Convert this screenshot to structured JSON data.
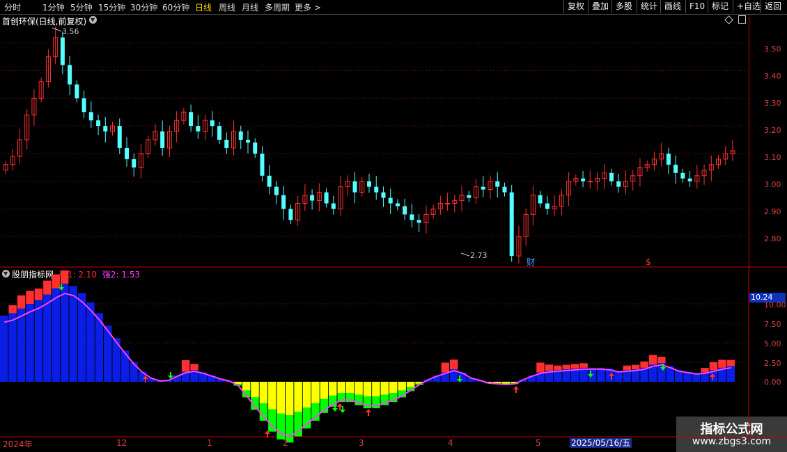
{
  "toolbar": {
    "periods": [
      "分时",
      "1分钟",
      "5分钟",
      "15分钟",
      "30分钟",
      "60分钟",
      "日线",
      "周线",
      "月线",
      "多周期",
      "更多 >"
    ],
    "active_period": "日线",
    "buttons": [
      "复权",
      "叠加",
      "多股",
      "统计",
      "画线",
      "F10",
      "标记",
      "+自选",
      "返回"
    ]
  },
  "main_chart": {
    "title": "首创环保(日线,前复权)",
    "high_label": "3.56",
    "low_label": "2.73",
    "marker_cai": "财",
    "marker_dollar": "$",
    "y_ticks": [
      "3.50",
      "3.40",
      "3.30",
      "3.20",
      "3.10",
      "3.00",
      "2.90",
      "2.80"
    ]
  },
  "indicator": {
    "name": "股朋指标网",
    "qiang1_label": "强1: 2.10",
    "qiang2_label": "强2: 1.53",
    "current_value": "10.24",
    "y_ticks": [
      "10.00",
      "7.50",
      "5.00",
      "2.50",
      "0.00"
    ]
  },
  "x_axis": {
    "labels": [
      "2024年",
      "12",
      "1",
      "2",
      "3",
      "4",
      "5"
    ],
    "date_box": "2025/05/16/五"
  },
  "watermark": {
    "line1": "指标公式网",
    "line2": "www.zbgs3.com"
  },
  "colors": {
    "up": "#ff3030",
    "down": "#54ffff",
    "bar_blue": "#0a1ee6",
    "bar_yellow": "#ffff00",
    "bar_green": "#00ff00",
    "line_magenta": "#ff40ff"
  },
  "chart_data": {
    "type": "candlestick",
    "y_range": [
      2.7,
      3.6
    ],
    "price_points": [
      3.06,
      3.09,
      3.15,
      3.24,
      3.3,
      3.36,
      3.45,
      3.52,
      3.42,
      3.35,
      3.3,
      3.25,
      3.22,
      3.2,
      3.18,
      3.2,
      3.12,
      3.08,
      3.05,
      3.1,
      3.15,
      3.18,
      3.12,
      3.18,
      3.22,
      3.25,
      3.2,
      3.18,
      3.22,
      3.2,
      3.15,
      3.12,
      3.18,
      3.15,
      3.14,
      3.1,
      3.02,
      2.98,
      2.95,
      2.9,
      2.86,
      2.92,
      2.95,
      2.93,
      2.96,
      2.92,
      2.9,
      2.98,
      3.0,
      2.96,
      3.0,
      2.98,
      2.96,
      2.94,
      2.92,
      2.91,
      2.88,
      2.86,
      2.85,
      2.88,
      2.9,
      2.92,
      2.92,
      2.93,
      2.95,
      2.94,
      2.98,
      2.97,
      3.0,
      2.98,
      2.96,
      2.73,
      2.8,
      2.88,
      2.95,
      2.92,
      2.9,
      2.91,
      2.95,
      3.0,
      3.01,
      3.0,
      3.0,
      3.01,
      3.03,
      3.0,
      2.98,
      3.0,
      3.02,
      3.05,
      3.06,
      3.08,
      3.1,
      3.06,
      3.03,
      3.01,
      3.0,
      3.02,
      3.04,
      3.06,
      3.08,
      3.1,
      3.11
    ],
    "indicator_series": [
      {
        "name": "强1",
        "value": 2.1
      },
      {
        "name": "强2",
        "value": 1.53
      }
    ],
    "indicator_bars": [
      8.5,
      8.8,
      9.4,
      10.0,
      10.5,
      11.2,
      12.0,
      12.6,
      12.3,
      11.4,
      10.2,
      8.8,
      7.2,
      5.6,
      4.0,
      2.5,
      1.3,
      0.5,
      0.1,
      0.2,
      0.8,
      1.3,
      1.5,
      1.2,
      0.8,
      0.4,
      0.1,
      -0.5,
      -2.0,
      -3.6,
      -5.0,
      -6.4,
      -7.4,
      -7.8,
      -7.0,
      -6.0,
      -5.0,
      -4.0,
      -3.2,
      -2.6,
      -2.6,
      -3.0,
      -3.4,
      -3.4,
      -3.0,
      -2.6,
      -2.0,
      -1.2,
      -0.4,
      0.3,
      0.8,
      1.2,
      1.6,
      1.2,
      0.5,
      0.2,
      -0.2,
      -0.3,
      -0.4,
      -0.3,
      0.3,
      0.8,
      1.2,
      1.4,
      1.5,
      1.6,
      1.7,
      1.8,
      1.8,
      1.8,
      1.7,
      1.4,
      1.5,
      1.6,
      1.8,
      2.2,
      2.4,
      2.0,
      1.5,
      1.3,
      1.1,
      1.2,
      1.5,
      1.8,
      2.0
    ]
  }
}
